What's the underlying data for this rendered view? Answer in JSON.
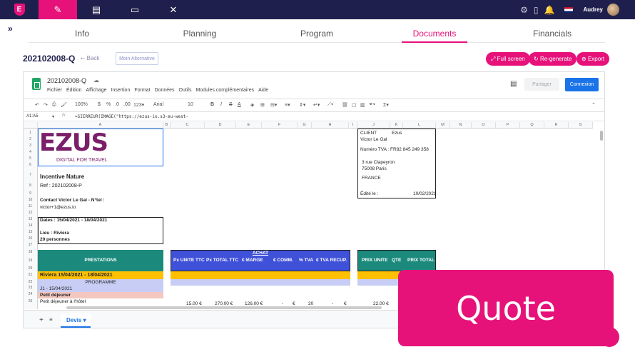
{
  "topbar": {
    "logo_letter": "E",
    "tabs": [
      {
        "icon": "edit-icon",
        "glyph": "✎"
      },
      {
        "icon": "book-icon",
        "glyph": "▤"
      },
      {
        "icon": "tablet-icon",
        "glyph": "▭"
      },
      {
        "icon": "tools-icon",
        "glyph": "✕"
      }
    ],
    "user_name": "Audrey"
  },
  "subnav": {
    "items": [
      "Info",
      "Planning",
      "Program",
      "Documents",
      "Financials"
    ],
    "active": "Documents"
  },
  "doc": {
    "title": "202102008-Q",
    "back_label": "Back",
    "alternative_label": "Moin Alternative",
    "buttons": {
      "fullscreen": "Full screen",
      "regenerate": "Re-generate",
      "export": "Export"
    }
  },
  "sheet": {
    "name": "202102008-Q",
    "menus": [
      "Fichier",
      "Édition",
      "Affichage",
      "Insertion",
      "Format",
      "Données",
      "Outils",
      "Modules complémentaires",
      "Aide"
    ],
    "share_label": "Partager",
    "connect_label": "Connexion",
    "toolbar": {
      "zoom": "100%",
      "font": "Arial",
      "size": "10"
    },
    "cell_ref": "A1:A5",
    "formula": "=SIERREUR(IMAGE(\"https://ezus-io.s3-eu-west-",
    "columns": [
      "A",
      "B",
      "C",
      "D",
      "E",
      "F",
      "G",
      "H",
      "I",
      "J",
      "K",
      "L",
      "M",
      "N",
      "O",
      "P",
      "Q",
      "R",
      "S"
    ],
    "rows": [
      "1",
      "2",
      "3",
      "4",
      "5",
      "6",
      "7",
      "8",
      "9",
      "10",
      "11",
      "12",
      "13",
      "14",
      "15",
      "16",
      "17",
      "18",
      "19",
      "20",
      "21",
      "22",
      "23",
      "24",
      "25"
    ],
    "brand": {
      "logo_text": "EZUS",
      "tagline": "DIGITAL FOR TRAVEL"
    },
    "company": "Incentive Nature",
    "ref": "Ref : 202102008-P",
    "contact": "Contact Victor Le Gal - N°tel :",
    "email": "victor+1@ezus.io",
    "dates": "Dates : 15/04/2021 - 18/04/2021",
    "place": "Lieu : Riviera",
    "people": "20 personnes",
    "client": {
      "label": "CLIENT",
      "name": "Ezus",
      "contact": "Victor Le Gal",
      "tva": "Numéro TVA : FR82 845 249 358",
      "address1": "3 rue Clapeyron",
      "address2": "75008 Paris",
      "country": "FRANCE",
      "edited_label": "Édité le :",
      "edited_date": "10/02/2021"
    },
    "headers": {
      "prestations": "PRESTATIONS",
      "achat": "ACHAT",
      "achat_cols": [
        "Px UNITE TTC",
        "Px TOTAL TTC",
        "€ MARGE",
        "€ COMM.",
        "% TVA",
        "€ TVA RECUP."
      ],
      "vente_cols": [
        "PRIX UNITE",
        "QTE",
        "PRIX TOTAL"
      ]
    },
    "section": "Riviera 15/04/2021 - 18/04/2021",
    "programme": "PROGRAMME",
    "day": "J1 - 15/04/2021",
    "meal": "Petit déjeuner",
    "line": {
      "label": "Petit déjeuner à l'hôtel",
      "unit": "15.00 €",
      "total": "270.00 €",
      "marge": "126.00 €",
      "comm_dash": "-",
      "comm_eur": "€",
      "tva": "20",
      "recup_dash": "-",
      "recup_eur": "€",
      "prix": "22.00 €"
    },
    "tab_name": "Devis"
  },
  "overlay": {
    "label": "Quote"
  },
  "colors": {
    "navy": "#1f1f4d",
    "pink": "#e6127a",
    "teal": "#1b8a7d",
    "blue": "#3f51d8",
    "yellow": "#ffc000",
    "lavender": "#c8cdf5",
    "salmon": "#f4c7c1"
  }
}
